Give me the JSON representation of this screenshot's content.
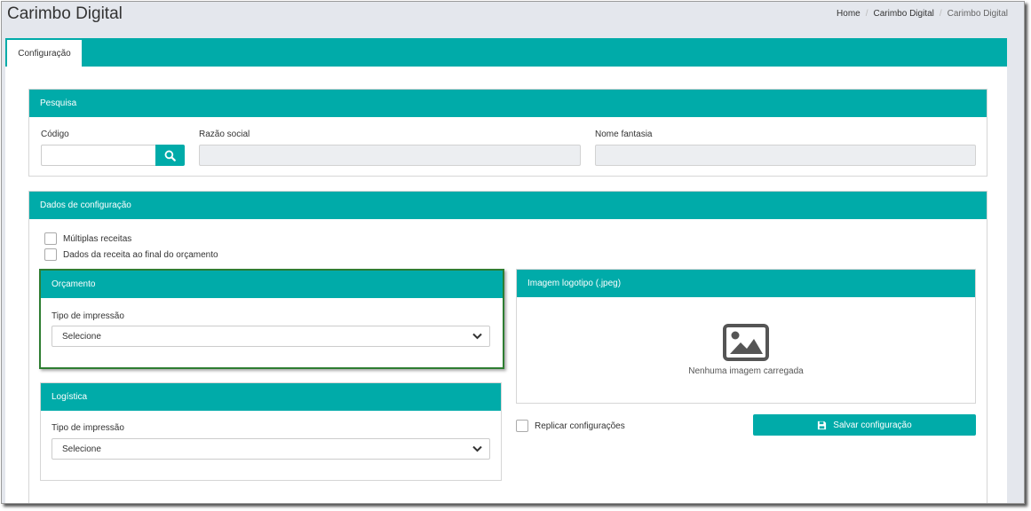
{
  "header": {
    "title": "Carimbo Digital",
    "breadcrumb": [
      "Home",
      "Carimbo Digital",
      "Carimbo Digital"
    ]
  },
  "tabs": [
    {
      "label": "Configuração"
    }
  ],
  "search_panel": {
    "title": "Pesquisa",
    "codigo_label": "Código",
    "razao_label": "Razão social",
    "fantasia_label": "Nome fantasia"
  },
  "config_panel": {
    "title": "Dados de configuração",
    "checkbox_multiplas": "Múltiplas receitas",
    "checkbox_dados": "Dados da receita ao final do orçamento"
  },
  "orcamento": {
    "title": "Orçamento",
    "tipo_label": "Tipo de impressão",
    "select_value": "Selecione"
  },
  "logistica": {
    "title": "Logística",
    "tipo_label": "Tipo de impressão",
    "select_value": "Selecione"
  },
  "logo_panel": {
    "title": "Imagem logotipo (.jpeg)",
    "empty_text": "Nenhuma imagem carregada"
  },
  "replicar_label": "Replicar configurações",
  "save_label": "Salvar configuração",
  "colors": {
    "accent": "#00aba9",
    "focus_border": "#2e7d32"
  },
  "icons": [
    "search-icon",
    "image-placeholder-icon",
    "save-icon",
    "chevron-down-icon"
  ]
}
